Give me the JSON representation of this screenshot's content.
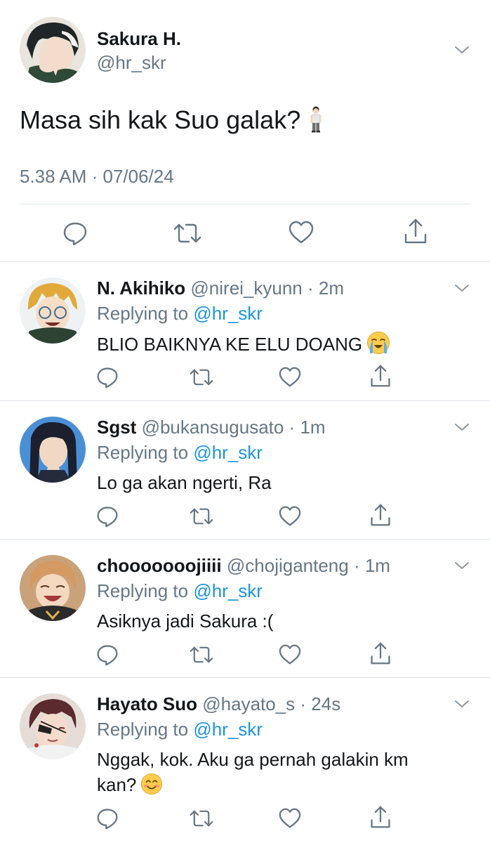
{
  "main_tweet": {
    "name": "Sakura H.",
    "handle": "@hr_skr",
    "text": "Masa sih kak Suo galak?",
    "time": "5.38 AM · 07/06/24"
  },
  "replies": [
    {
      "name": "N. Akihiko",
      "meta": "@nirei_kyunn · 2m",
      "replying_prefix": "Replying to ",
      "replying_to": "@hr_skr",
      "text": "BLIO BAIKNYA KE ELU DOANG"
    },
    {
      "name": "Sgst",
      "meta": "@bukansugusato · 1m",
      "replying_prefix": "Replying to ",
      "replying_to": "@hr_skr",
      "text": "Lo ga akan ngerti, Ra"
    },
    {
      "name": "chooooooojiiii",
      "meta": "@chojiganteng · 1m",
      "replying_prefix": "Replying to ",
      "replying_to": "@hr_skr",
      "text": "Asiknya jadi Sakura :("
    },
    {
      "name": "Hayato Suo",
      "meta": "@hayato_s · 24s",
      "replying_prefix": "Replying to ",
      "replying_to": "@hr_skr",
      "text": "Nggak, kok. Aku ga pernah galakin km kan?"
    }
  ],
  "icons": [
    "chevron-down-icon",
    "reply-icon",
    "retweet-icon",
    "like-icon",
    "share-icon",
    "person-standing-emoji",
    "crying-emoji",
    "smiling-emoji"
  ],
  "colors": {
    "text": "#14171a",
    "secondary": "#657786",
    "link": "#1b95e0",
    "divider": "#e1e8ed"
  }
}
